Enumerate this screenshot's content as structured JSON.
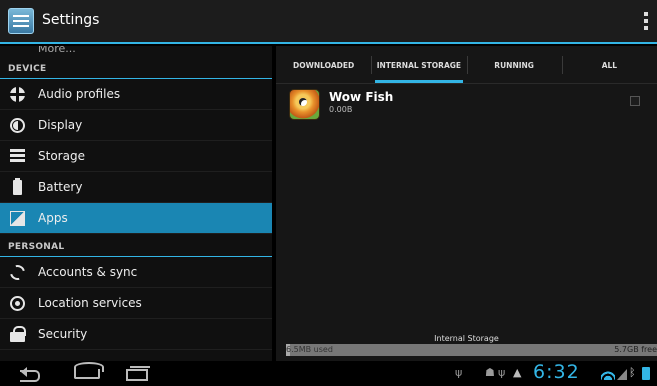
{
  "actionbar": {
    "title": "Settings",
    "app_icon": "settings-icon",
    "overflow_icon": "overflow-menu-icon"
  },
  "sidebar": {
    "more_label": "More...",
    "device_header": "DEVICE",
    "device_items": [
      {
        "label": "Audio profiles",
        "icon": "audio-profiles-icon"
      },
      {
        "label": "Display",
        "icon": "display-icon"
      },
      {
        "label": "Storage",
        "icon": "storage-icon"
      },
      {
        "label": "Battery",
        "icon": "battery-icon"
      },
      {
        "label": "Apps",
        "icon": "apps-icon",
        "selected": true
      }
    ],
    "personal_header": "PERSONAL",
    "personal_items": [
      {
        "label": "Accounts & sync",
        "icon": "sync-icon"
      },
      {
        "label": "Location services",
        "icon": "location-icon"
      },
      {
        "label": "Security",
        "icon": "lock-icon"
      }
    ]
  },
  "tabs": [
    "DOWNLOADED",
    "INTERNAL STORAGE",
    "RUNNING",
    "ALL"
  ],
  "active_tab": "INTERNAL STORAGE",
  "apps": [
    {
      "name": "Wow Fish",
      "size": "0.00B"
    }
  ],
  "storage": {
    "label": "Internal Storage",
    "used": "6.5MB used",
    "free": "5.7GB free"
  },
  "statusbar": {
    "time": "6:32"
  },
  "colors": {
    "accent": "#33b5e5",
    "selected": "#1a86b3"
  }
}
